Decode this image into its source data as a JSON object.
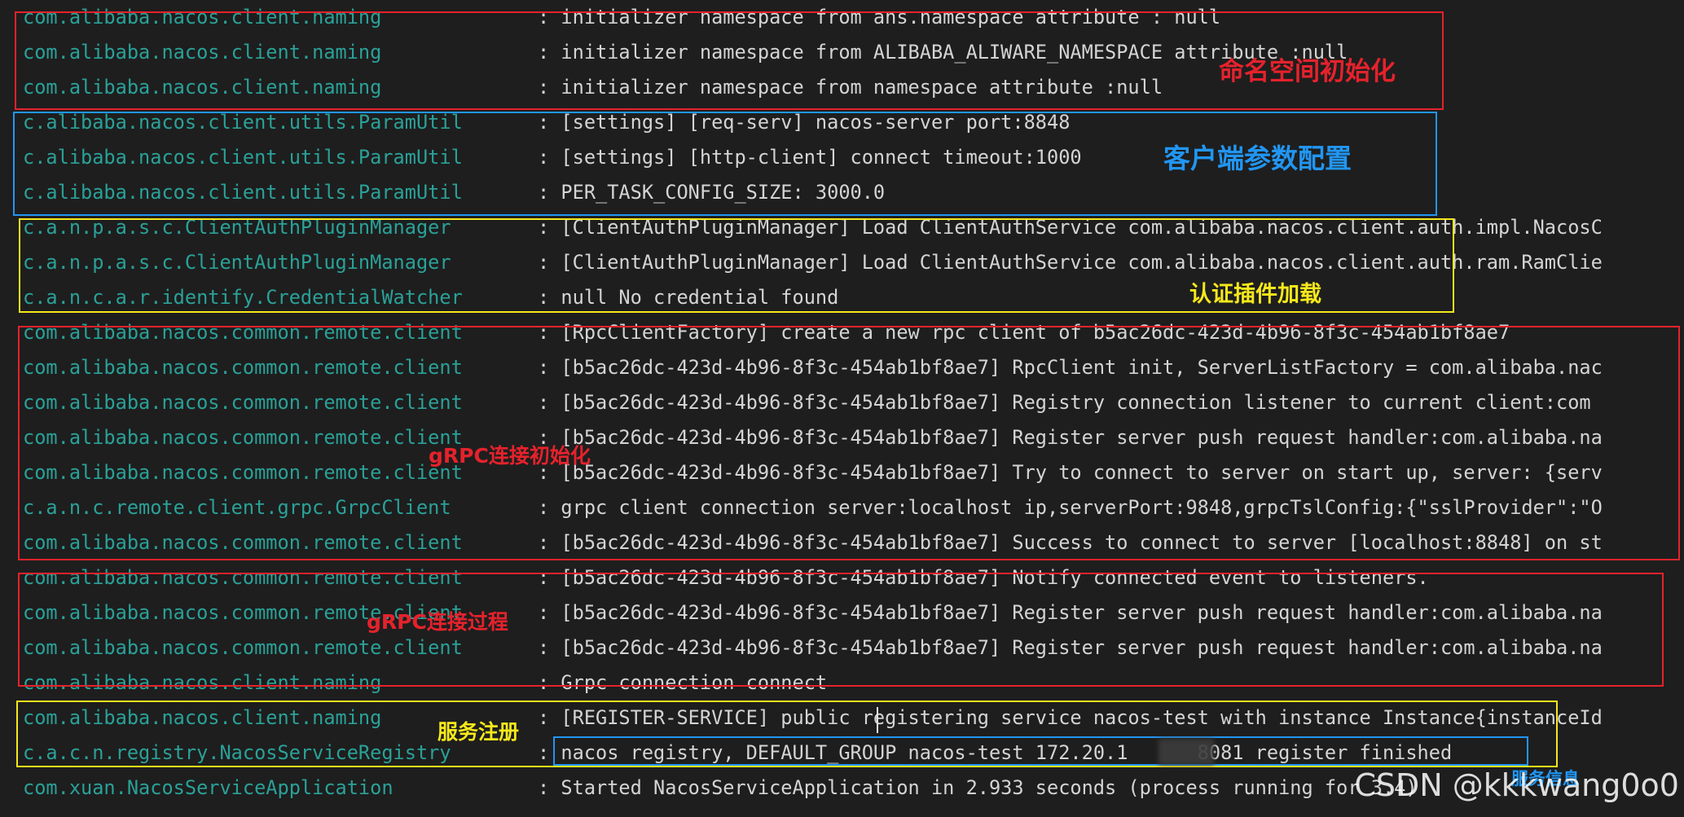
{
  "log_lines": [
    {
      "logger": "com.alibaba.nacos.client.naming",
      "message": ": initializer namespace from ans.namespace attribute : null"
    },
    {
      "logger": "com.alibaba.nacos.client.naming",
      "message": ": initializer namespace from ALIBABA_ALIWARE_NAMESPACE attribute :null"
    },
    {
      "logger": "com.alibaba.nacos.client.naming",
      "message": ": initializer namespace from namespace attribute :null"
    },
    {
      "logger": "c.alibaba.nacos.client.utils.ParamUtil",
      "message": ": [settings] [req-serv] nacos-server port:8848"
    },
    {
      "logger": "c.alibaba.nacos.client.utils.ParamUtil",
      "message": ": [settings] [http-client] connect timeout:1000"
    },
    {
      "logger": "c.alibaba.nacos.client.utils.ParamUtil",
      "message": ": PER_TASK_CONFIG_SIZE: 3000.0"
    },
    {
      "logger": "c.a.n.p.a.s.c.ClientAuthPluginManager",
      "message": ": [ClientAuthPluginManager] Load ClientAuthService com.alibaba.nacos.client.auth.impl.NacosC"
    },
    {
      "logger": "c.a.n.p.a.s.c.ClientAuthPluginManager",
      "message": ": [ClientAuthPluginManager] Load ClientAuthService com.alibaba.nacos.client.auth.ram.RamClie"
    },
    {
      "logger": "c.a.n.c.a.r.identify.CredentialWatcher",
      "message": ": null No credential found"
    },
    {
      "logger": "com.alibaba.nacos.common.remote.client",
      "message": ": [RpcClientFactory] create a new rpc client of b5ac26dc-423d-4b96-8f3c-454ab1bf8ae7"
    },
    {
      "logger": "com.alibaba.nacos.common.remote.client",
      "message": ": [b5ac26dc-423d-4b96-8f3c-454ab1bf8ae7] RpcClient init, ServerListFactory = com.alibaba.nac"
    },
    {
      "logger": "com.alibaba.nacos.common.remote.client",
      "message": ": [b5ac26dc-423d-4b96-8f3c-454ab1bf8ae7] Registry connection listener to current client:com"
    },
    {
      "logger": "com.alibaba.nacos.common.remote.client",
      "message": ": [b5ac26dc-423d-4b96-8f3c-454ab1bf8ae7] Register server push request handler:com.alibaba.na"
    },
    {
      "logger": "com.alibaba.nacos.common.remote.client",
      "message": ": [b5ac26dc-423d-4b96-8f3c-454ab1bf8ae7] Try to connect to server on start up, server: {serv"
    },
    {
      "logger": "c.a.n.c.remote.client.grpc.GrpcClient",
      "message": ": grpc client connection server:localhost ip,serverPort:9848,grpcTslConfig:{\"sslProvider\":\"O"
    },
    {
      "logger": "com.alibaba.nacos.common.remote.client",
      "message": ": [b5ac26dc-423d-4b96-8f3c-454ab1bf8ae7] Success to connect to server [localhost:8848] on st"
    },
    {
      "logger": "com.alibaba.nacos.common.remote.client",
      "message": ": [b5ac26dc-423d-4b96-8f3c-454ab1bf8ae7] Notify connected event to listeners."
    },
    {
      "logger": "com.alibaba.nacos.common.remote.client",
      "message": ": [b5ac26dc-423d-4b96-8f3c-454ab1bf8ae7] Register server push request handler:com.alibaba.na"
    },
    {
      "logger": "com.alibaba.nacos.common.remote.client",
      "message": ": [b5ac26dc-423d-4b96-8f3c-454ab1bf8ae7] Register server push request handler:com.alibaba.na"
    },
    {
      "logger": "com.alibaba.nacos.client.naming",
      "message": ": Grpc connection connect"
    },
    {
      "logger": "com.alibaba.nacos.client.naming",
      "message": ": [REGISTER-SERVICE] public registering service nacos-test with instance Instance{instanceId"
    },
    {
      "logger": "c.a.c.n.registry.NacosServiceRegistry",
      "message": ": nacos registry, DEFAULT_GROUP nacos-test 172.20.1      8081 register finished"
    },
    {
      "logger": "com.xuan.NacosServiceApplication",
      "message": ": Started NacosServiceApplication in 2.933 seconds (process running for 3.4)"
    }
  ],
  "annotations": {
    "namespace_init": "命名空间初始化",
    "client_params": "客户端参数配置",
    "auth_plugin": "认证插件加载",
    "grpc_init": "gRPC连接初始化",
    "grpc_process": "gRPC连接过程",
    "service_register": "服务注册",
    "service_info": "服务信息"
  },
  "watermark": "CSDN @kkkwang0o0",
  "colors": {
    "background": "#1e1e1e",
    "logger": "#2aa198",
    "message": "#d4d4d4",
    "annotation_red": "#e5222c",
    "annotation_blue": "#2196f3",
    "annotation_yellow": "#f6e81b"
  }
}
